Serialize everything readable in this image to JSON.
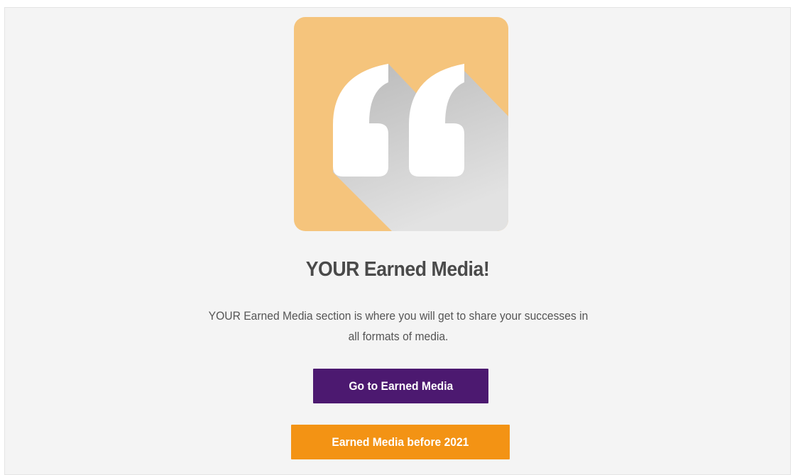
{
  "card": {
    "icon": "quote-marks-icon",
    "title": "YOUR Earned Media!",
    "description": "YOUR Earned Media section is where you will get to share your successes in all formats of media.",
    "primary_button": "Go to Earned Media",
    "secondary_button": "Earned Media before 2021"
  },
  "colors": {
    "icon_background": "#f5c47c",
    "icon_shadow": "#c8c8c8",
    "primary_button": "#4c1970",
    "secondary_button": "#f39314",
    "panel_background": "#f4f4f4",
    "title_text": "#4a4a4a"
  }
}
